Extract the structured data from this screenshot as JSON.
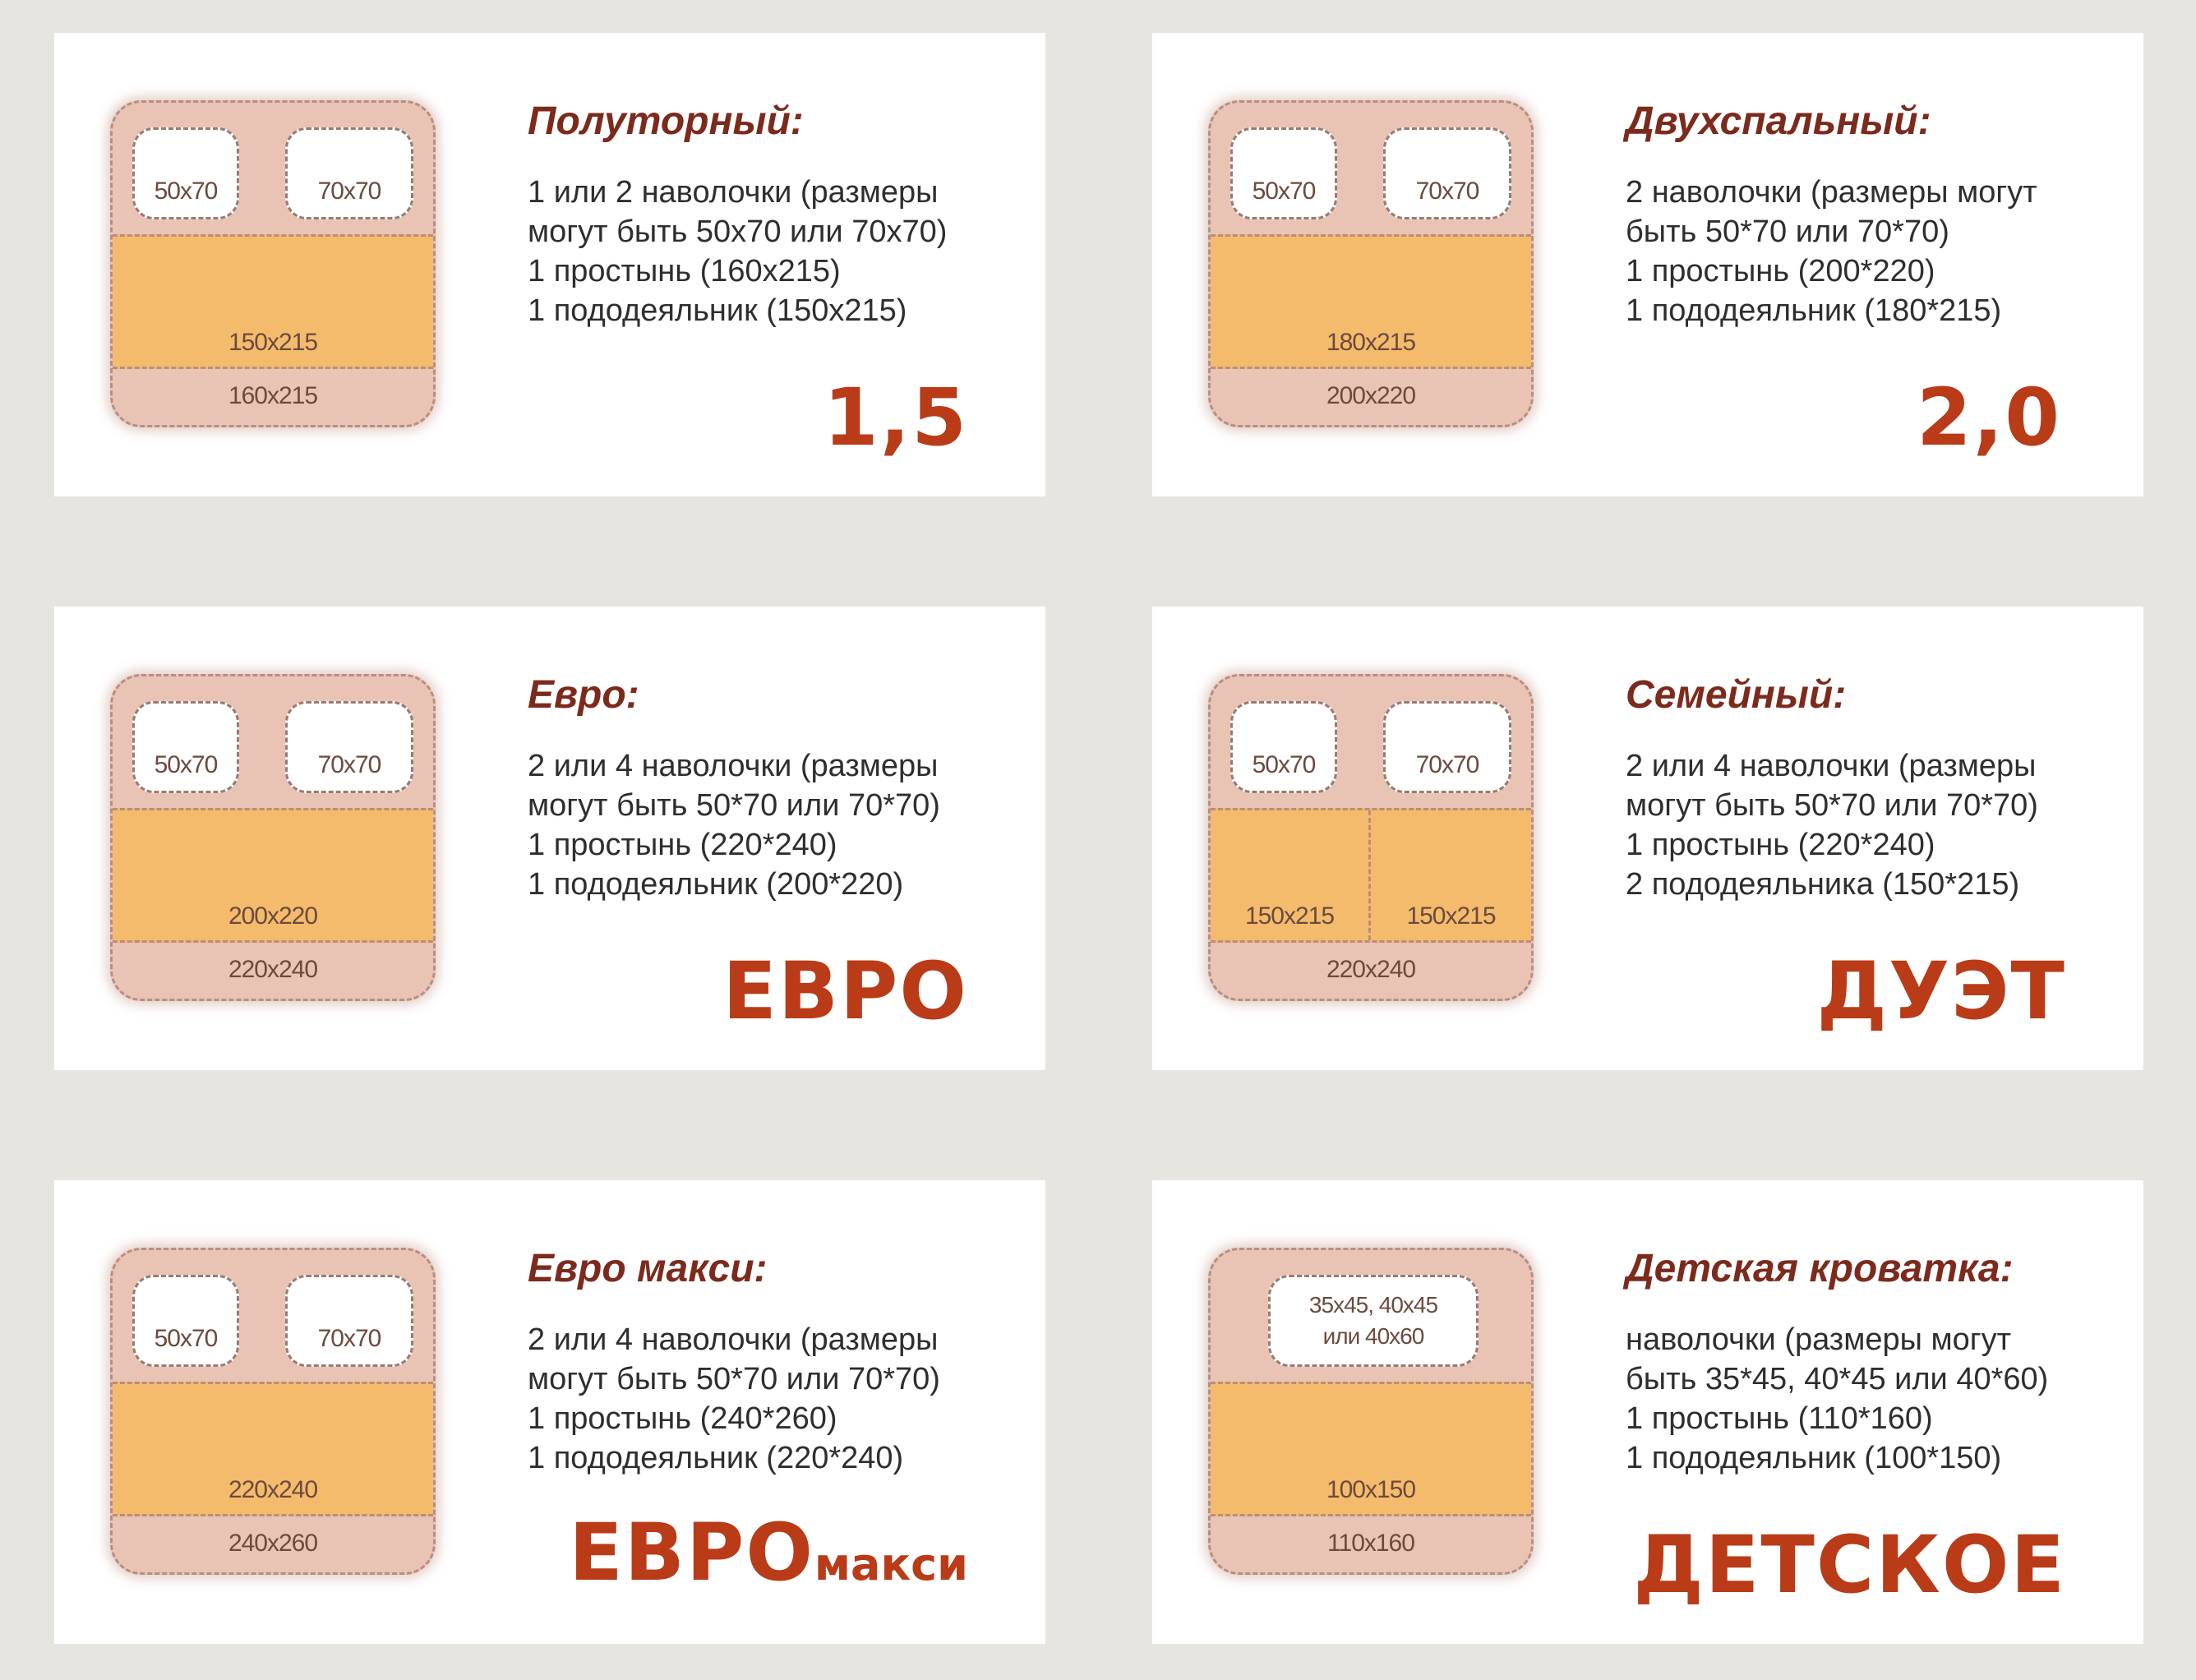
{
  "cards": [
    {
      "title": "Полуторный:",
      "lines": [
        "1 или 2 наволочки (размеры",
        "могут быть 50х70 или 70х70)",
        "1 простынь (160х215)",
        "1 пододеяльник (150х215)"
      ],
      "badge": "1,5",
      "badge_suffix": "",
      "pillows": [
        "50х70",
        "70х70"
      ],
      "duvet": "150х215",
      "sheet": "160х215"
    },
    {
      "title": "Двухспальный:",
      "lines": [
        "2 наволочки (размеры могут",
        "быть 50*70 или 70*70)",
        "1 простынь (200*220)",
        "1 пододеяльник (180*215)"
      ],
      "badge": "2,0",
      "badge_suffix": "",
      "pillows": [
        "50х70",
        "70х70"
      ],
      "duvet": "180х215",
      "sheet": "200х220"
    },
    {
      "title": "Евро:",
      "lines": [
        "2 или 4 наволочки (размеры",
        "могут быть 50*70 или 70*70)",
        "1 простынь (220*240)",
        "1 пододеяльник (200*220)"
      ],
      "badge": "ЕВРО",
      "badge_suffix": "",
      "pillows": [
        "50х70",
        "70х70"
      ],
      "duvet": "200х220",
      "sheet": "220х240"
    },
    {
      "title": "Семейный:",
      "lines": [
        "2 или 4 наволочки (размеры",
        "могут быть 50*70 или 70*70)",
        "1 простынь (220*240)",
        "2 пододеяльника (150*215)"
      ],
      "badge": "ДУЭТ",
      "badge_suffix": "",
      "pillows": [
        "50х70",
        "70х70"
      ],
      "duvet_left": "150х215",
      "duvet_right": "150х215",
      "sheet": "220х240"
    },
    {
      "title": "Евро макси:",
      "lines": [
        "2 или 4 наволочки (размеры",
        "могут быть 50*70 или 70*70)",
        "1 простынь (240*260)",
        "1 пододеяльник (220*240)"
      ],
      "badge": "ЕВРО",
      "badge_suffix": "макси",
      "pillows": [
        "50х70",
        "70х70"
      ],
      "duvet": "220х240",
      "sheet": "240х260"
    },
    {
      "title": "Детская кроватка:",
      "lines": [
        "наволочки (размеры могут",
        "быть 35*45, 40*45 или 40*60)",
        "1 простынь (110*160)",
        "1 пододеяльник (100*150)"
      ],
      "badge": "ДЕТСКОЕ",
      "badge_suffix": "",
      "pillow_single": [
        "35х45, 40х45",
        "или 40х60"
      ],
      "duvet": "100х150",
      "sheet": "110х160"
    }
  ],
  "colors": {
    "background": "#e6e5df",
    "card": "#ffffff",
    "bed": "#e9c4b4",
    "duvet": "#f5bb6d",
    "title": "#7c2a1c",
    "badge": "#b93b17"
  }
}
